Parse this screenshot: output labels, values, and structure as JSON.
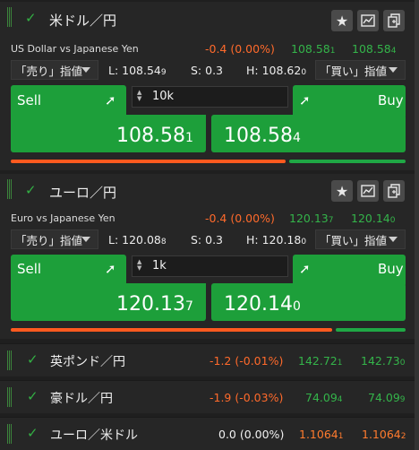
{
  "colors": {
    "accent_green": "#1d9f3a",
    "sell_bar": "#ff5a1f",
    "buy_bar": "#1fa845",
    "down": "#ff6a2b",
    "up": "#34b44a"
  },
  "icons": [
    "checkmark-icon",
    "star-icon",
    "chart-icon",
    "detach-icon",
    "up-right-arrow-icon",
    "spinner-icon",
    "caret-down-icon"
  ],
  "usdjpy": {
    "title": "米ドル／円",
    "subtitle": "US Dollar vs Japanese Yen",
    "change": "-0.4 (0.00%)",
    "bid_small": "108.58",
    "bid_small_pip": "1",
    "ask_small": "108.58",
    "ask_small_pip": "4",
    "sell_order": "「売り」指値",
    "buy_order": "「買い」指値",
    "low": "L: 108.54",
    "low_pip": "9",
    "spread": "S: 0.3",
    "high": "H: 108.62",
    "high_pip": "0",
    "sell_label": "Sell",
    "buy_label": "Buy",
    "qty": "10k",
    "sell_big": "108.58",
    "sell_pip": "1",
    "buy_big": "108.58",
    "buy_pip": "4"
  },
  "eurjpy": {
    "title": "ユーロ／円",
    "subtitle": "Euro vs Japanese Yen",
    "change": "-0.4 (0.00%)",
    "bid_small": "120.13",
    "bid_small_pip": "7",
    "ask_small": "120.14",
    "ask_small_pip": "0",
    "sell_order": "「売り」指値",
    "buy_order": "「買い」指値",
    "low": "L: 120.08",
    "low_pip": "8",
    "spread": "S: 0.3",
    "high": "H: 120.18",
    "high_pip": "0",
    "sell_label": "Sell",
    "buy_label": "Buy",
    "qty": "1k",
    "sell_big": "120.13",
    "sell_pip": "7",
    "buy_big": "120.14",
    "buy_pip": "0"
  },
  "rows": [
    {
      "title": "英ポンド／円",
      "change": "-1.2 (-0.01%)",
      "bid": "142.72",
      "bid_pip": "1",
      "ask": "142.73",
      "ask_pip": "0"
    },
    {
      "title": "豪ドル／円",
      "change": "-1.9 (-0.03%)",
      "bid": "74.09",
      "bid_pip": "4",
      "ask": "74.09",
      "ask_pip": "9"
    },
    {
      "title": "ユーロ／米ドル",
      "change": "0.0 (0.00%)",
      "bid": "1.1064",
      "bid_pip": "1",
      "ask": "1.1064",
      "ask_pip": "2"
    }
  ]
}
